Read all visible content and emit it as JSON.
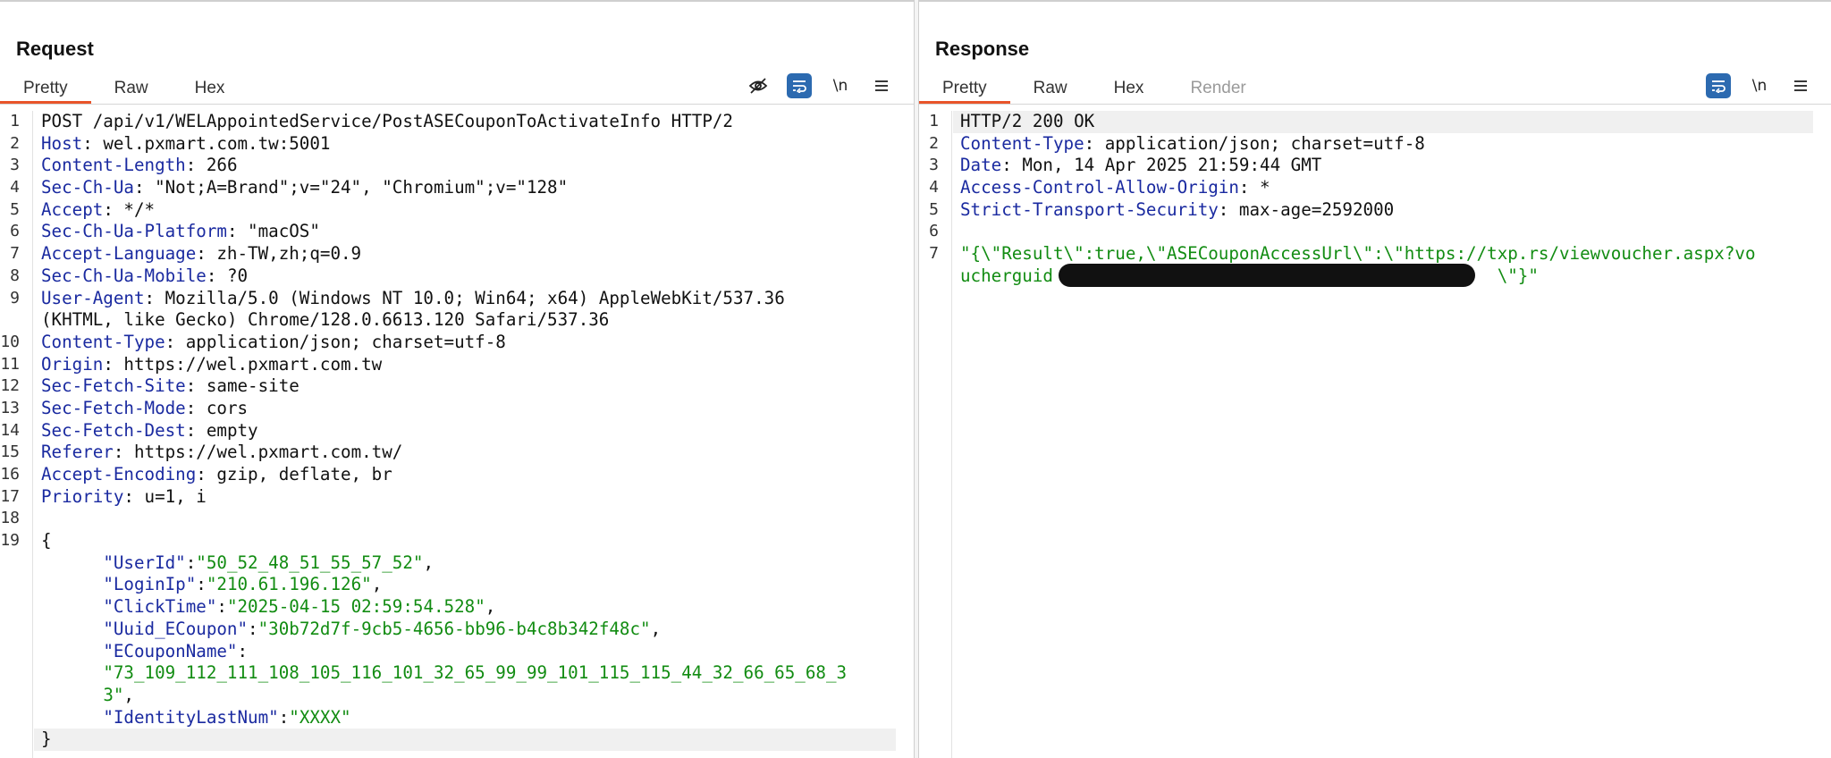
{
  "request": {
    "title": "Request",
    "tabs": [
      "Pretty",
      "Raw",
      "Hex"
    ],
    "active_tab": "Pretty",
    "tools": {
      "hide_icon": "eye-slash-icon",
      "wrap_icon": "wrap-icon",
      "newline_label": "\\n",
      "menu_icon": "hamburger-menu-icon"
    },
    "lines": [
      {
        "n": "1",
        "parts": [
          [
            "v",
            "POST /api/v1/WELAppointedService/PostASECouponToActivateInfo HTTP/2"
          ]
        ]
      },
      {
        "n": "2",
        "parts": [
          [
            "k",
            "Host"
          ],
          [
            "v",
            ": wel.pxmart.com.tw:5001"
          ]
        ]
      },
      {
        "n": "3",
        "parts": [
          [
            "k",
            "Content-Length"
          ],
          [
            "v",
            ": 266"
          ]
        ]
      },
      {
        "n": "4",
        "parts": [
          [
            "k",
            "Sec-Ch-Ua"
          ],
          [
            "v",
            ": \"Not;A=Brand\";v=\"24\", \"Chromium\";v=\"128\""
          ]
        ]
      },
      {
        "n": "5",
        "parts": [
          [
            "k",
            "Accept"
          ],
          [
            "v",
            ": */*"
          ]
        ]
      },
      {
        "n": "6",
        "parts": [
          [
            "k",
            "Sec-Ch-Ua-Platform"
          ],
          [
            "v",
            ": \"macOS\""
          ]
        ]
      },
      {
        "n": "7",
        "parts": [
          [
            "k",
            "Accept-Language"
          ],
          [
            "v",
            ": zh-TW,zh;q=0.9"
          ]
        ]
      },
      {
        "n": "8",
        "parts": [
          [
            "k",
            "Sec-Ch-Ua-Mobile"
          ],
          [
            "v",
            ": ?0"
          ]
        ]
      },
      {
        "n": "9",
        "parts": [
          [
            "k",
            "User-Agent"
          ],
          [
            "v",
            ": Mozilla/5.0 (Windows NT 10.0; Win64; x64) AppleWebKit/537.36"
          ]
        ]
      },
      {
        "n": "",
        "parts": [
          [
            "v",
            "(KHTML, like Gecko) Chrome/128.0.6613.120 Safari/537.36"
          ]
        ]
      },
      {
        "n": "10",
        "parts": [
          [
            "k",
            "Content-Type"
          ],
          [
            "v",
            ": application/json; charset=utf-8"
          ]
        ]
      },
      {
        "n": "11",
        "parts": [
          [
            "k",
            "Origin"
          ],
          [
            "v",
            ": https://wel.pxmart.com.tw"
          ]
        ]
      },
      {
        "n": "12",
        "parts": [
          [
            "k",
            "Sec-Fetch-Site"
          ],
          [
            "v",
            ": same-site"
          ]
        ]
      },
      {
        "n": "13",
        "parts": [
          [
            "k",
            "Sec-Fetch-Mode"
          ],
          [
            "v",
            ": cors"
          ]
        ]
      },
      {
        "n": "14",
        "parts": [
          [
            "k",
            "Sec-Fetch-Dest"
          ],
          [
            "v",
            ": empty"
          ]
        ]
      },
      {
        "n": "15",
        "parts": [
          [
            "k",
            "Referer"
          ],
          [
            "v",
            ": https://wel.pxmart.com.tw/"
          ]
        ]
      },
      {
        "n": "16",
        "parts": [
          [
            "k",
            "Accept-Encoding"
          ],
          [
            "v",
            ": gzip, deflate, br"
          ]
        ]
      },
      {
        "n": "17",
        "parts": [
          [
            "k",
            "Priority"
          ],
          [
            "v",
            ": u=1, i"
          ]
        ]
      },
      {
        "n": "18",
        "parts": []
      },
      {
        "n": "19",
        "parts": [
          [
            "p",
            "{"
          ]
        ]
      },
      {
        "n": "",
        "parts": [
          [
            "p",
            "      "
          ],
          [
            "k",
            "\"UserId\""
          ],
          [
            "p",
            ":"
          ],
          [
            "s",
            "\"50_52_48_51_55_57_52\""
          ],
          [
            "p",
            ","
          ]
        ]
      },
      {
        "n": "",
        "parts": [
          [
            "p",
            "      "
          ],
          [
            "k",
            "\"LoginIp\""
          ],
          [
            "p",
            ":"
          ],
          [
            "s",
            "\"210.61.196.126\""
          ],
          [
            "p",
            ","
          ]
        ]
      },
      {
        "n": "",
        "parts": [
          [
            "p",
            "      "
          ],
          [
            "k",
            "\"ClickTime\""
          ],
          [
            "p",
            ":"
          ],
          [
            "s",
            "\"2025-04-15 02:59:54.528\""
          ],
          [
            "p",
            ","
          ]
        ]
      },
      {
        "n": "",
        "parts": [
          [
            "p",
            "      "
          ],
          [
            "k",
            "\"Uuid_ECoupon\""
          ],
          [
            "p",
            ":"
          ],
          [
            "s",
            "\"30b72d7f-9cb5-4656-bb96-b4c8b342f48c\""
          ],
          [
            "p",
            ","
          ]
        ]
      },
      {
        "n": "",
        "parts": [
          [
            "p",
            "      "
          ],
          [
            "k",
            "\"ECouponName\""
          ],
          [
            "p",
            ":"
          ]
        ]
      },
      {
        "n": "",
        "parts": [
          [
            "p",
            "      "
          ],
          [
            "s",
            "\"73_109_112_111_108_105_116_101_32_65_99_99_101_115_115_44_32_66_65_68_3"
          ]
        ]
      },
      {
        "n": "",
        "parts": [
          [
            "p",
            "      "
          ],
          [
            "s",
            "3\""
          ],
          [
            "p",
            ","
          ]
        ]
      },
      {
        "n": "",
        "parts": [
          [
            "p",
            "      "
          ],
          [
            "k",
            "\"IdentityLastNum\""
          ],
          [
            "p",
            ":"
          ],
          [
            "s",
            "\"XXXX\""
          ]
        ]
      },
      {
        "n": "",
        "parts": [
          [
            "p",
            "}"
          ]
        ],
        "highlight": true
      }
    ]
  },
  "response": {
    "title": "Response",
    "tabs": [
      "Pretty",
      "Raw",
      "Hex",
      "Render"
    ],
    "active_tab": "Pretty",
    "disabled_tab": "Render",
    "tools": {
      "wrap_icon": "wrap-icon",
      "newline_label": "\\n",
      "menu_icon": "hamburger-menu-icon"
    },
    "lines": [
      {
        "n": "1",
        "parts": [
          [
            "v",
            "HTTP/2 200 OK"
          ]
        ],
        "highlight": true
      },
      {
        "n": "2",
        "parts": [
          [
            "k",
            "Content-Type"
          ],
          [
            "v",
            ": application/json; charset=utf-8"
          ]
        ]
      },
      {
        "n": "3",
        "parts": [
          [
            "k",
            "Date"
          ],
          [
            "v",
            ": Mon, 14 Apr 2025 21:59:44 GMT"
          ]
        ]
      },
      {
        "n": "4",
        "parts": [
          [
            "k",
            "Access-Control-Allow-Origin"
          ],
          [
            "v",
            ": *"
          ]
        ]
      },
      {
        "n": "5",
        "parts": [
          [
            "k",
            "Strict-Transport-Security"
          ],
          [
            "v",
            ": max-age=2592000"
          ]
        ]
      },
      {
        "n": "6",
        "parts": []
      },
      {
        "n": "7",
        "parts": [
          [
            "s",
            "\"{\\\"Result\\\":true,\\\"ASECouponAccessUrl\\\":\\\"https://txp.rs/viewvoucher.aspx?vo"
          ]
        ]
      },
      {
        "n": "",
        "parts": [
          [
            "s",
            "ucherguid"
          ],
          [
            "s",
            "                                           "
          ],
          [
            "s",
            "\\\"}\""
          ]
        ],
        "redacted": true
      }
    ]
  },
  "layout_buttons": [
    "split-columns-icon",
    "split-rows-icon",
    "single-pane-icon"
  ]
}
